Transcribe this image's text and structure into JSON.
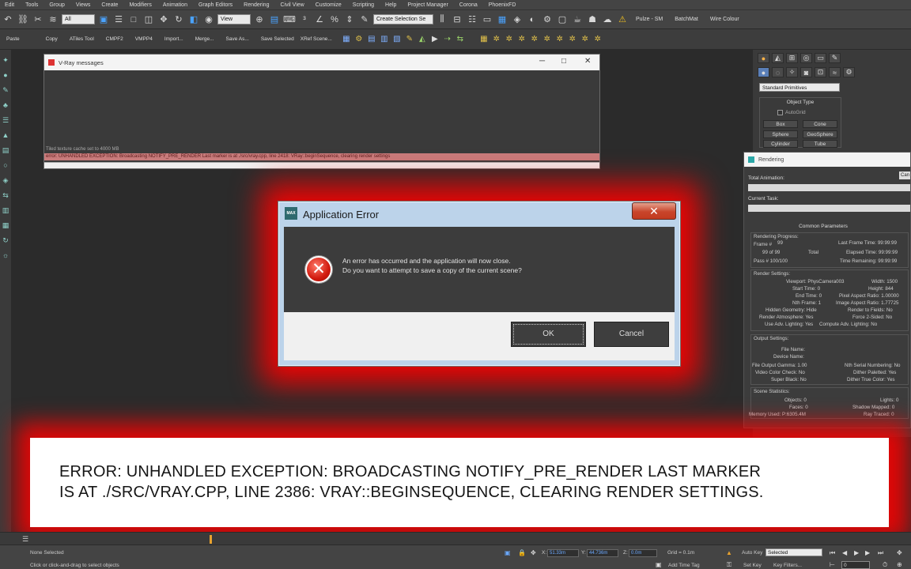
{
  "menubar": [
    "Edit",
    "Tools",
    "Group",
    "Views",
    "Create",
    "Modifiers",
    "Animation",
    "Graph Editors",
    "Rendering",
    "Civil View",
    "Customize",
    "Scripting",
    "Help",
    "Project Manager",
    "Corona",
    "PhoenixFD"
  ],
  "toolbar1": {
    "selection_filter": "All",
    "reference_coord": "View",
    "named_selection": "Create Selection Se",
    "right_items": [
      "Pulze - SM",
      "BatchMat",
      "Wire Colour"
    ]
  },
  "toolbar2": [
    "Paste",
    "Copy",
    "ATiles Tool",
    "CMPF2",
    "VMPP4",
    "Import...",
    "Merge...",
    "Save As...",
    "Save Selected",
    "XRef Scene..."
  ],
  "command_panel": {
    "dropdown": "Standard Primitives",
    "object_type_title": "Object Type",
    "autogrid": "AutoGrid",
    "buttons": [
      "Box",
      "Cone",
      "Sphere",
      "GeoSphere",
      "Cylinder",
      "Tube"
    ]
  },
  "rendering": {
    "title": "Rendering",
    "total_animation": "Total Animation:",
    "current_task": "Current Task:",
    "cancel": "Can",
    "common": "Common Parameters",
    "progress_title": "Rendering Progress:",
    "frame_label": "Frame #",
    "frame_value": "99",
    "of_value": "99 of 99",
    "total": "Total",
    "pass": "Pass #  100/100",
    "last_frame": "Last Frame Time: 99:99:99",
    "elapsed": "Elapsed Time: 99:99:99",
    "remaining": "Time Remaining: 99:99:99",
    "settings_title": "Render Settings:",
    "settings_left": [
      "Viewport: PhysCamera003",
      "Start Time: 0",
      "End Time: 0",
      "Nth Frame: 1",
      "Hidden Geometry: Hide",
      "Render Atmosphere: Yes",
      "Use Adv. Lighting: Yes"
    ],
    "settings_right": [
      "Width: 1500",
      "Height: 844",
      "Pixel Aspect Ratio: 1.00000",
      "Image Aspect Ratio: 1.77725",
      "Render to Fields: No",
      "Force 2-Sided: No",
      "Compute Adv. Lighting: No"
    ],
    "output_title": "Output Settings:",
    "output_left": [
      "File Name:",
      "Device Name:",
      "File Output Gamma: 1.00",
      "Video Color Check: No",
      "Super Black: No"
    ],
    "output_right": [
      "Nth Serial Numbering: No",
      "Dither Paletted: Yes",
      "Dither True Color: Yes"
    ],
    "scene_title": "Scene Statistics:",
    "scene_left": [
      "Objects: 0",
      "Faces: 0",
      "Memory Used: P:6305.4M"
    ],
    "scene_right": [
      "Lights: 0",
      "Shadow Mapped: 0",
      "Ray Traced: 0"
    ]
  },
  "vray": {
    "title": "V-Ray messages",
    "minimize": "─",
    "maximize": "□",
    "close": "✕",
    "log_line": "Tiled texture cache set to 4000 MB",
    "error_line": "error: UNHANDLED EXCEPTION: Broadcasting NOTIFY_PRE_RENDER Last marker is at ./src/vray.cpp, line 2418: VRay::beginSequence, clearing render settings"
  },
  "app_error": {
    "logo": "MAX",
    "title": "Application Error",
    "close": "✕",
    "icon": "✕",
    "line1": "An error has occurred and the application will now close.",
    "line2": "Do you want to attempt to save a copy of the current scene?",
    "ok": "OK",
    "cancel": "Cancel"
  },
  "banner": {
    "line1": "ERROR: UNHANDLED EXCEPTION: BROADCASTING NOTIFY_PRE_RENDER LAST MARKER",
    "line2": "IS AT ./SRC/VRAY.CPP, LINE 2386: VRAY::BEGINSEQUENCE, CLEARING RENDER SETTINGS."
  },
  "status": {
    "selection": "None Selected",
    "prompt": "Click or click-and-drag to select objects",
    "x_label": "X:",
    "x_value": "51.33m",
    "y_label": "Y:",
    "y_value": "44.736m",
    "z_label": "Z:",
    "z_value": "0.0m",
    "grid": "Grid = 0.1m",
    "add_time_tag": "Add Time Tag",
    "auto_key": "Auto Key",
    "selected": "Selected",
    "set_key": "Set Key",
    "key_filters": "Key Filters...",
    "frame": "0"
  },
  "colors": {
    "glow": "#ff0000",
    "dialog_frame": "#bcd3ea",
    "close_button": "#c9452b",
    "error_row": "#c87b7b"
  }
}
